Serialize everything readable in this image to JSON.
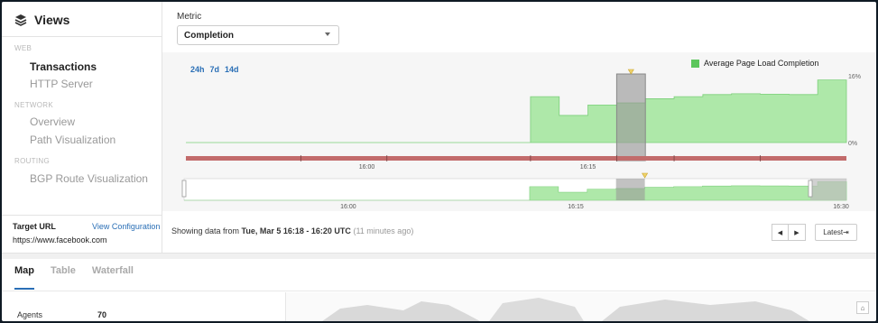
{
  "sidebar": {
    "title": "Views",
    "sections": [
      {
        "label": "WEB",
        "items": [
          {
            "label": "Transactions",
            "active": true
          },
          {
            "label": "HTTP Server",
            "active": false
          }
        ]
      },
      {
        "label": "NETWORK",
        "items": [
          {
            "label": "Overview",
            "active": false
          },
          {
            "label": "Path Visualization",
            "active": false
          }
        ]
      },
      {
        "label": "ROUTING",
        "items": [
          {
            "label": "BGP Route Visualization",
            "active": false
          }
        ]
      }
    ],
    "target_url_label": "Target URL",
    "view_configuration": "View Configuration",
    "target_url": "https://www.facebook.com"
  },
  "metric": {
    "label": "Metric",
    "selected": "Completion"
  },
  "range_links": [
    "24h",
    "7d",
    "14d"
  ],
  "legend": {
    "label": "Average Page Load Completion",
    "color": "#5cc65c"
  },
  "status": {
    "prefix": "Showing data from ",
    "range": "Tue, Mar 5 16:18 - 16:20 UTC",
    "ago": "(11 minutes ago)"
  },
  "pager": {
    "prev": "◀",
    "next": "▶",
    "latest": "Latest⇥"
  },
  "tabs": [
    {
      "label": "Map",
      "active": true
    },
    {
      "label": "Table",
      "active": false
    },
    {
      "label": "Waterfall",
      "active": false
    }
  ],
  "agents": {
    "label": "Agents",
    "value": "70"
  },
  "chart_data": {
    "type": "area",
    "title": "",
    "ylabel": "",
    "y_tick_labels": [
      "16%",
      "0%"
    ],
    "ylim": [
      0,
      16
    ],
    "x_tick_labels": [
      "16:00",
      "16:15"
    ],
    "overview_x_tick_labels": [
      "16:00",
      "16:15",
      "16:30"
    ],
    "series": [
      {
        "name": "Average Page Load Completion",
        "color": "#aee8a9",
        "x": [
          "15:48",
          "15:50",
          "15:52",
          "15:54",
          "15:56",
          "15:58",
          "16:00",
          "16:02",
          "16:04",
          "16:06",
          "16:08",
          "16:10",
          "16:12",
          "16:14",
          "16:16",
          "16:18",
          "16:20",
          "16:22",
          "16:24",
          "16:26",
          "16:28",
          "16:30",
          "16:32"
        ],
        "values": [
          0,
          0,
          0,
          0,
          0,
          0,
          0,
          0,
          0,
          0,
          0,
          0,
          11,
          6.5,
          9,
          9.5,
          10.5,
          11,
          11.5,
          11.7,
          11.6,
          11.5,
          15
        ]
      }
    ],
    "selected_range": [
      "16:18",
      "16:20"
    ],
    "grid": false,
    "legend_position": "top-right"
  }
}
